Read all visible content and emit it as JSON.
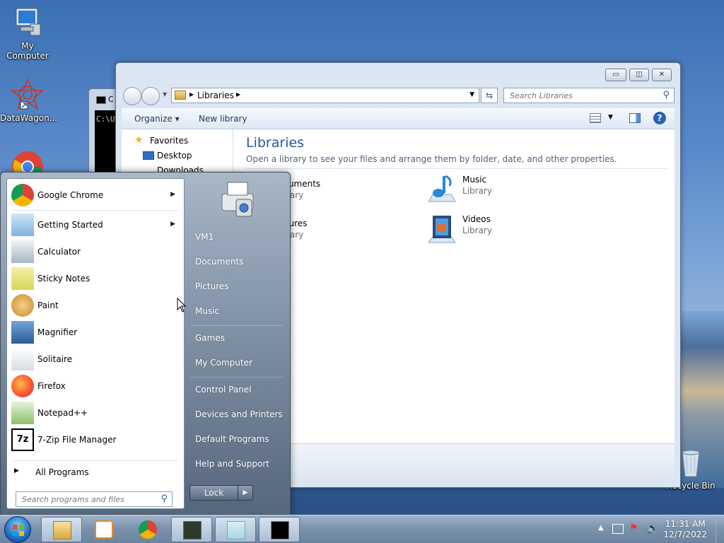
{
  "desktop": {
    "icons": [
      {
        "label": "My Computer",
        "icon": "computer-icon"
      },
      {
        "label": "DataWagon...",
        "icon": "datawagon-shortcut-icon"
      },
      {
        "label": "Recycle Bin",
        "icon": "recycle-bin-icon"
      }
    ]
  },
  "cmd_window": {
    "title": "C",
    "text": "C:\\U"
  },
  "explorer": {
    "breadcrumb": "Libraries",
    "search_placeholder": "Search Libraries",
    "toolbar": {
      "organize": "Organize",
      "new_library": "New library"
    },
    "nav": {
      "favorites": "Favorites",
      "desktop": "Desktop",
      "downloads": "Downloads"
    },
    "heading": "Libraries",
    "subheading": "Open a library to see your files and arrange them by folder, date, and other properties.",
    "libraries": [
      {
        "name": "ocuments",
        "type": "ibrary"
      },
      {
        "name": "Music",
        "type": "Library"
      },
      {
        "name": "ictures",
        "type": "ibrary"
      },
      {
        "name": "Videos",
        "type": "Library"
      }
    ]
  },
  "start_menu": {
    "programs": [
      {
        "label": "Google Chrome",
        "icon": "chrome-icon",
        "has_submenu": true
      },
      {
        "label": "Getting Started",
        "icon": "getting-started-icon",
        "has_submenu": true
      },
      {
        "label": "Calculator",
        "icon": "calculator-icon",
        "has_submenu": false
      },
      {
        "label": "Sticky Notes",
        "icon": "sticky-notes-icon",
        "has_submenu": false
      },
      {
        "label": "Paint",
        "icon": "paint-icon",
        "has_submenu": false
      },
      {
        "label": "Magnifier",
        "icon": "magnifier-icon",
        "has_submenu": false
      },
      {
        "label": "Solitaire",
        "icon": "solitaire-icon",
        "has_submenu": false
      },
      {
        "label": "Firefox",
        "icon": "firefox-icon",
        "has_submenu": false
      },
      {
        "label": "Notepad++",
        "icon": "notepad-plus-plus-icon",
        "has_submenu": false
      },
      {
        "label": "7-Zip File Manager",
        "icon": "seven-zip-icon",
        "has_submenu": false
      }
    ],
    "all_programs": "All Programs",
    "search_placeholder": "Search programs and files",
    "right_items": [
      "VM1",
      "Documents",
      "Pictures",
      "Music",
      "Games",
      "My Computer",
      "Control Panel",
      "Devices and Printers",
      "Default Programs",
      "Help and Support"
    ],
    "lock_label": "Lock"
  },
  "taskbar": {
    "time": "11:31 AM",
    "date": "12/7/2022"
  }
}
